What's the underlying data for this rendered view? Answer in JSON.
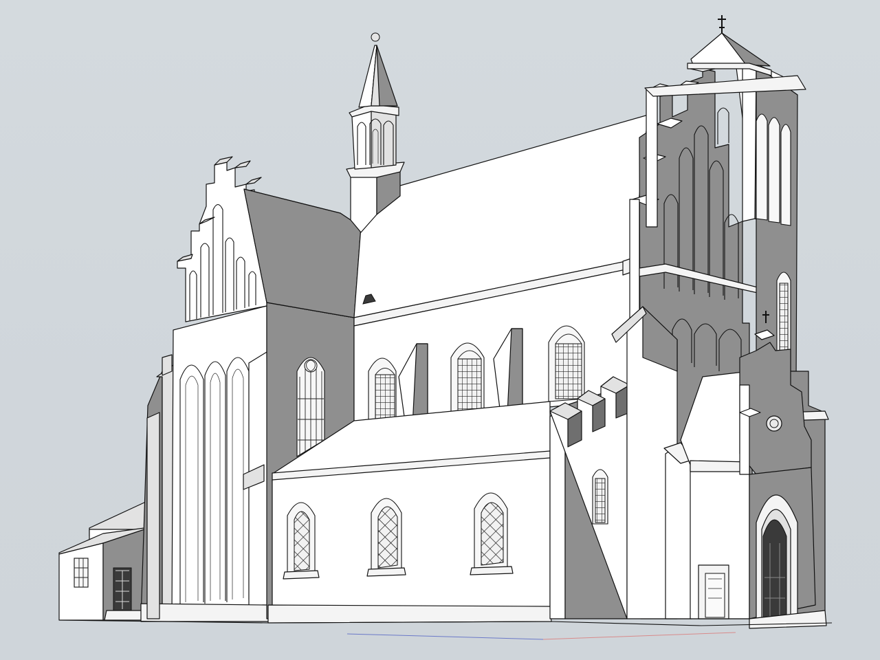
{
  "scene": {
    "subject": "",
    "colors": {
      "background": "#d3d9de",
      "wall_light": "#ffffff",
      "wall_shadow": "#8f8f8f",
      "wall_dark": "#6f6f6f",
      "outline": "#111111"
    }
  }
}
